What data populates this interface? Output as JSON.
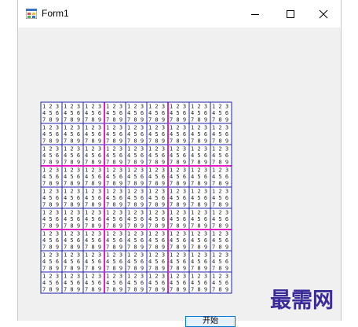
{
  "window": {
    "title": "Form1"
  },
  "titlebar_buttons": [
    {
      "name": "minimize-button",
      "icon": "minimize-icon"
    },
    {
      "name": "maximize-button",
      "icon": "maximize-icon"
    },
    {
      "name": "close-button",
      "icon": "close-icon"
    }
  ],
  "sudoku": {
    "rows": 9,
    "cols": 9,
    "candidate_rows": [
      "1 2 3",
      "4 5 6",
      "7 8 9"
    ],
    "cell_border_color": "#1e1ea8",
    "box_border_color": "#e020c0"
  },
  "button": {
    "label": "开始"
  },
  "watermark": {
    "text": "最需网"
  }
}
